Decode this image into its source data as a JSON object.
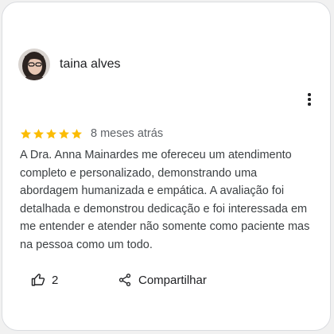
{
  "review": {
    "author": "taina alves",
    "rating": 5,
    "rating_max": 5,
    "date": "8 meses atrás",
    "text": "A Dra. Anna Mainardes me ofereceu um atendimento completo e personalizado, demonstrando uma abordagem humanizada e empática. A avaliação foi detalhada e demonstrou dedicação e foi interessada em me entender e atender não somente como paciente mas na pessoa como um todo.",
    "like_count": "2",
    "share_label": "Compartilhar"
  },
  "icons": {
    "star": "star-icon",
    "more": "more-vert-icon",
    "like": "thumbs-up-icon",
    "share": "share-icon"
  },
  "colors": {
    "star": "#fbbc04",
    "text": "#3c4043",
    "meta": "#5f6368"
  }
}
